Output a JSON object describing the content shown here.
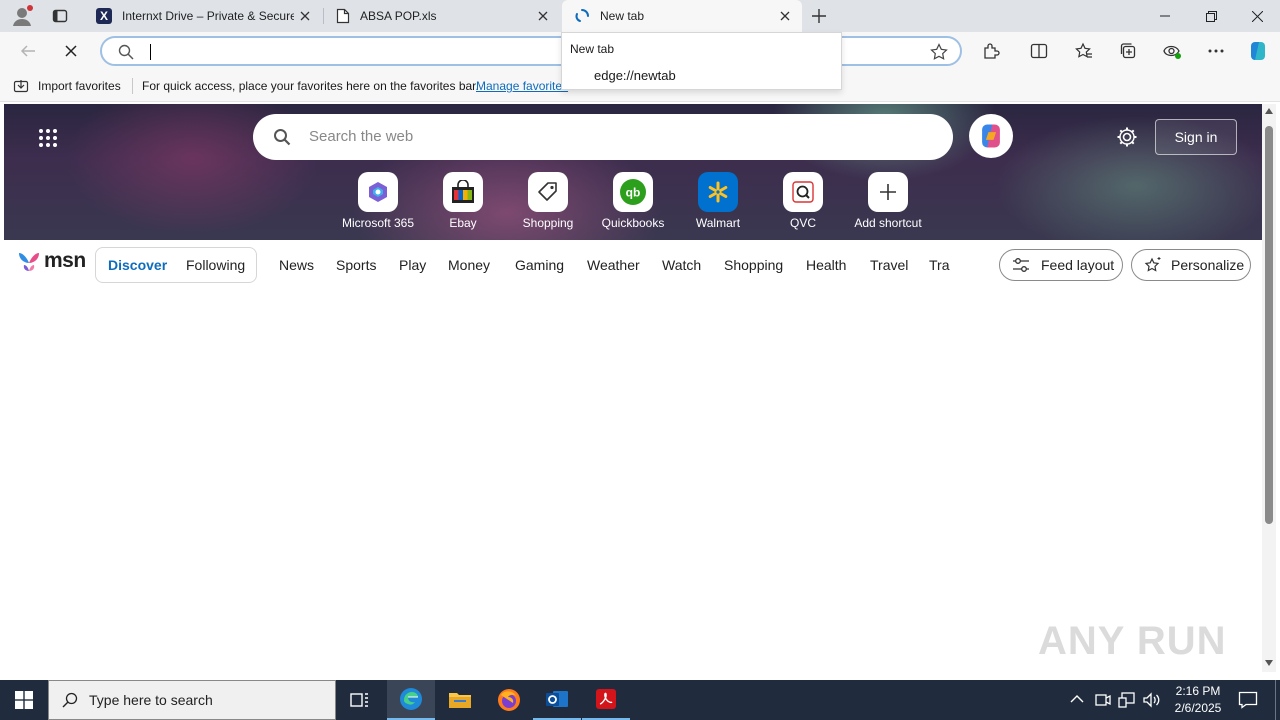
{
  "browser": {
    "tabs": [
      {
        "label": "Internxt Drive – Private & Secure",
        "icon": "internxt-x-icon"
      },
      {
        "label": "ABSA POP.xls",
        "icon": "document-icon"
      },
      {
        "label": "New tab",
        "icon": "loading-icon",
        "active": true
      }
    ],
    "address": {
      "value": "",
      "placeholder": ""
    },
    "suggestion": {
      "header": "New tab",
      "item": "edge://newtab"
    }
  },
  "favorites_bar": {
    "import_label": "Import favorites",
    "message": "For quick access, place your favorites here on the favorites bar.",
    "manage_link": "Manage favorites"
  },
  "newtab": {
    "search_placeholder": "Search the web",
    "sign_in": "Sign in",
    "shortcuts": [
      {
        "label": "Microsoft 365",
        "icon": "microsoft365-icon"
      },
      {
        "label": "Ebay",
        "icon": "ebay-bag-icon"
      },
      {
        "label": "Shopping",
        "icon": "price-tag-icon"
      },
      {
        "label": "Quickbooks",
        "icon": "quickbooks-icon"
      },
      {
        "label": "Walmart",
        "icon": "walmart-spark-icon"
      },
      {
        "label": "QVC",
        "icon": "qvc-icon"
      },
      {
        "label": "Add shortcut",
        "icon": "plus-icon"
      }
    ]
  },
  "msn": {
    "logo": "msn",
    "toggle": {
      "discover": "Discover",
      "following": "Following"
    },
    "nav": [
      "News",
      "Sports",
      "Play",
      "Money",
      "Gaming",
      "Weather",
      "Watch",
      "Shopping",
      "Health",
      "Travel",
      "Tra"
    ],
    "feed_layout": "Feed layout",
    "personalize": "Personalize"
  },
  "taskbar": {
    "search_placeholder": "Type here to search",
    "time": "2:16 PM",
    "date": "2/6/2025"
  },
  "watermark": "ANY RUN",
  "colors": {
    "accent": "#0f6cbd",
    "taskbar": "#202c3e",
    "tabstrip": "#dfe3e8"
  }
}
